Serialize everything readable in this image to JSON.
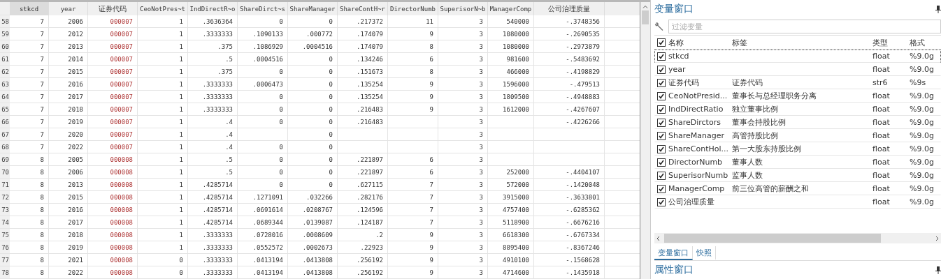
{
  "table": {
    "columns": [
      {
        "label": "stkcd",
        "kind": "numeric",
        "selected": true
      },
      {
        "label": "year",
        "kind": "numeric",
        "selected": false
      },
      {
        "label": "证券代码",
        "kind": "string",
        "selected": false
      },
      {
        "label": "CeoNotPres~t",
        "kind": "numeric",
        "selected": false
      },
      {
        "label": "IndDirectR~o",
        "kind": "numeric",
        "selected": false
      },
      {
        "label": "ShareDirct~s",
        "kind": "numeric",
        "selected": false
      },
      {
        "label": "ShareManager",
        "kind": "numeric",
        "selected": false
      },
      {
        "label": "ShareContH~r",
        "kind": "numeric",
        "selected": false
      },
      {
        "label": "DirectorNumb",
        "kind": "numeric",
        "selected": false
      },
      {
        "label": "SuperisorN~b",
        "kind": "numeric",
        "selected": false
      },
      {
        "label": "ManagerComp",
        "kind": "numeric",
        "selected": false
      },
      {
        "label": "公司治理质量",
        "kind": "numeric",
        "selected": false
      }
    ],
    "rows": [
      {
        "number": "58",
        "cells": [
          "7",
          "2006",
          "000007",
          "1",
          ".3636364",
          "0",
          "0",
          ".217372",
          "11",
          "3",
          "540000",
          "-.3748356"
        ]
      },
      {
        "number": "59",
        "cells": [
          "7",
          "2012",
          "000007",
          "1",
          ".3333333",
          ".1090133",
          ".000772",
          ".174079",
          "9",
          "3",
          "1080000",
          "-.2690535"
        ]
      },
      {
        "number": "60",
        "cells": [
          "7",
          "2013",
          "000007",
          "1",
          ".375",
          ".1086929",
          ".0004516",
          ".174079",
          "8",
          "3",
          "1080000",
          "-.2973879"
        ]
      },
      {
        "number": "61",
        "cells": [
          "7",
          "2014",
          "000007",
          "1",
          ".5",
          ".0004516",
          "0",
          ".134246",
          "6",
          "3",
          "981600",
          "-.5483692"
        ]
      },
      {
        "number": "62",
        "cells": [
          "7",
          "2015",
          "000007",
          "1",
          ".375",
          "0",
          "0",
          ".151673",
          "8",
          "3",
          "466000",
          "-.4198829"
        ]
      },
      {
        "number": "63",
        "cells": [
          "7",
          "2016",
          "000007",
          "1",
          ".3333333",
          ".0006473",
          "0",
          ".135254",
          "9",
          "3",
          "1596000",
          "-.479513"
        ]
      },
      {
        "number": "64",
        "cells": [
          "7",
          "2017",
          "000007",
          "1",
          ".3333333",
          "0",
          "0",
          ".135254",
          "9",
          "3",
          "1809500",
          "-.4948883"
        ]
      },
      {
        "number": "65",
        "cells": [
          "7",
          "2018",
          "000007",
          "1",
          ".3333333",
          "0",
          "0",
          ".216483",
          "9",
          "3",
          "1612000",
          "-.4267607"
        ]
      },
      {
        "number": "66",
        "cells": [
          "7",
          "2019",
          "000007",
          "1",
          ".4",
          "0",
          "0",
          ".216483",
          null,
          "3",
          null,
          "-.4226266"
        ]
      },
      {
        "number": "67",
        "cells": [
          "7",
          "2020",
          "000007",
          "1",
          ".4",
          null,
          "0",
          null,
          null,
          "3",
          null,
          null
        ]
      },
      {
        "number": "68",
        "cells": [
          "7",
          "2022",
          "000007",
          "1",
          ".4",
          "0",
          "0",
          null,
          null,
          "3",
          null,
          null
        ]
      },
      {
        "number": "69",
        "cells": [
          "8",
          "2005",
          "000008",
          "1",
          ".5",
          "0",
          "0",
          ".221897",
          "6",
          "3",
          null,
          null
        ]
      },
      {
        "number": "70",
        "cells": [
          "8",
          "2006",
          "000008",
          "1",
          ".5",
          "0",
          "0",
          ".221897",
          "6",
          "3",
          "252000",
          "-.4404107"
        ]
      },
      {
        "number": "71",
        "cells": [
          "8",
          "2013",
          "000008",
          "1",
          ".4285714",
          "0",
          "0",
          ".627115",
          "7",
          "3",
          "572000",
          "-.1420048"
        ]
      },
      {
        "number": "72",
        "cells": [
          "8",
          "2015",
          "000008",
          "1",
          ".4285714",
          ".1271091",
          ".032266",
          ".282176",
          "7",
          "3",
          "3915000",
          "-.3633801"
        ]
      },
      {
        "number": "73",
        "cells": [
          "8",
          "2016",
          "000008",
          "1",
          ".4285714",
          ".0691614",
          ".0208767",
          ".124596",
          "7",
          "3",
          "4757400",
          "-.6285362"
        ]
      },
      {
        "number": "74",
        "cells": [
          "8",
          "2017",
          "000008",
          "1",
          ".4285714",
          ".0689344",
          ".0139087",
          ".124187",
          "7",
          "3",
          "5118900",
          "-.6676216"
        ]
      },
      {
        "number": "75",
        "cells": [
          "8",
          "2018",
          "000008",
          "1",
          ".3333333",
          ".0728016",
          ".0008609",
          ".2",
          "9",
          "3",
          "6618300",
          "-.6767334"
        ]
      },
      {
        "number": "76",
        "cells": [
          "8",
          "2019",
          "000008",
          "1",
          ".3333333",
          ".0552572",
          ".0002673",
          ".22923",
          "9",
          "3",
          "8895400",
          "-.8367246"
        ]
      },
      {
        "number": "77",
        "cells": [
          "8",
          "2021",
          "000008",
          "0",
          ".3333333",
          ".0413194",
          ".0413808",
          ".256192",
          "9",
          "3",
          "4910100",
          "-.1568628"
        ]
      },
      {
        "number": "78",
        "cells": [
          "8",
          "2022",
          "000008",
          "0",
          ".3333333",
          ".0413194",
          ".0413808",
          ".256192",
          "9",
          "3",
          "4714600",
          "-.1435918"
        ]
      }
    ]
  },
  "variables_panel": {
    "title": "变量窗口",
    "filter": {
      "placeholder": "过滤变量"
    },
    "header": {
      "checked": true,
      "columns": [
        "名称",
        "标签",
        "类型",
        "格式"
      ]
    },
    "variables": [
      {
        "name": "stkcd",
        "type": "float",
        "format": "%9.0g",
        "checked": true,
        "selected": true
      },
      {
        "name": "year",
        "type": "float",
        "format": "%9.0g",
        "checked": true,
        "selected": false
      },
      {
        "name": "证券代码",
        "label": "证券代码",
        "type": "str6",
        "format": "%9s",
        "checked": true,
        "selected": false
      },
      {
        "name": "CeoNotPresid...",
        "label": "董事长与总经理职务分离",
        "type": "float",
        "format": "%9.0g",
        "checked": true,
        "selected": false
      },
      {
        "name": "IndDirectRatio",
        "label": "独立董事比例",
        "type": "float",
        "format": "%9.0g",
        "checked": true,
        "selected": false
      },
      {
        "name": "ShareDirctors",
        "label": "董事会持股比例",
        "type": "float",
        "format": "%9.0g",
        "checked": true,
        "selected": false
      },
      {
        "name": "ShareManager",
        "label": "高管持股比例",
        "type": "float",
        "format": "%9.0g",
        "checked": true,
        "selected": false
      },
      {
        "name": "ShareContHol...",
        "label": "第一大股东持股比例",
        "type": "float",
        "format": "%9.0g",
        "checked": true,
        "selected": false
      },
      {
        "name": "DirectorNumb",
        "label": "董事人数",
        "type": "float",
        "format": "%9.0g",
        "checked": true,
        "selected": false
      },
      {
        "name": "SuperisorNumb",
        "label": "监事人数",
        "type": "float",
        "format": "%9.0g",
        "checked": true,
        "selected": false
      },
      {
        "name": "ManagerComp",
        "label": "前三位高管的薪酬之和",
        "type": "float",
        "format": "%9.0g",
        "checked": true,
        "selected": false
      },
      {
        "name": "公司治理质量",
        "type": "float",
        "format": "%9.0g",
        "checked": true,
        "selected": false
      }
    ],
    "tabs": [
      {
        "label": "变量窗口",
        "selected": true
      },
      {
        "label": "快照",
        "selected": false
      }
    ]
  },
  "properties_panel": {
    "title": "属性窗口"
  }
}
